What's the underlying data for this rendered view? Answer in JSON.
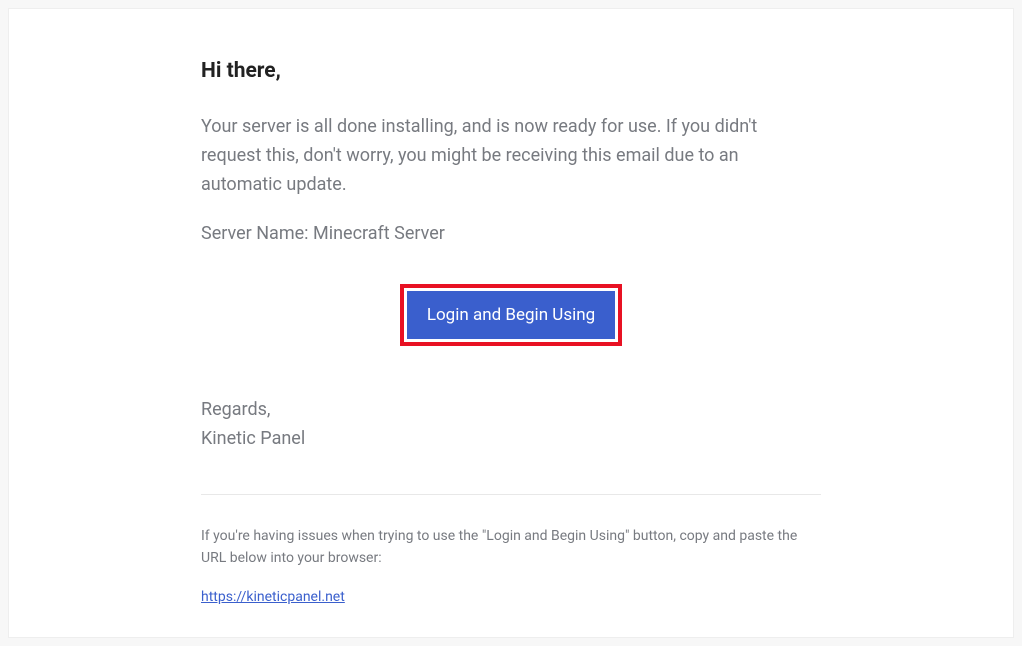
{
  "email": {
    "greeting": "Hi there,",
    "body": "Your server is all done installing, and is now ready for use. If you didn't request this, don't worry, you might be receiving this email due to an automatic update.",
    "server_label": "Server Name: Minecraft Server",
    "button_label": "Login and Begin Using",
    "signoff_regards": "Regards,",
    "signoff_name": "Kinetic Panel",
    "footer_help": "If you're having issues when trying to use the \"Login and Begin Using\" button, copy and paste the URL below into your browser:",
    "footer_url": "https://kineticpanel.net"
  }
}
